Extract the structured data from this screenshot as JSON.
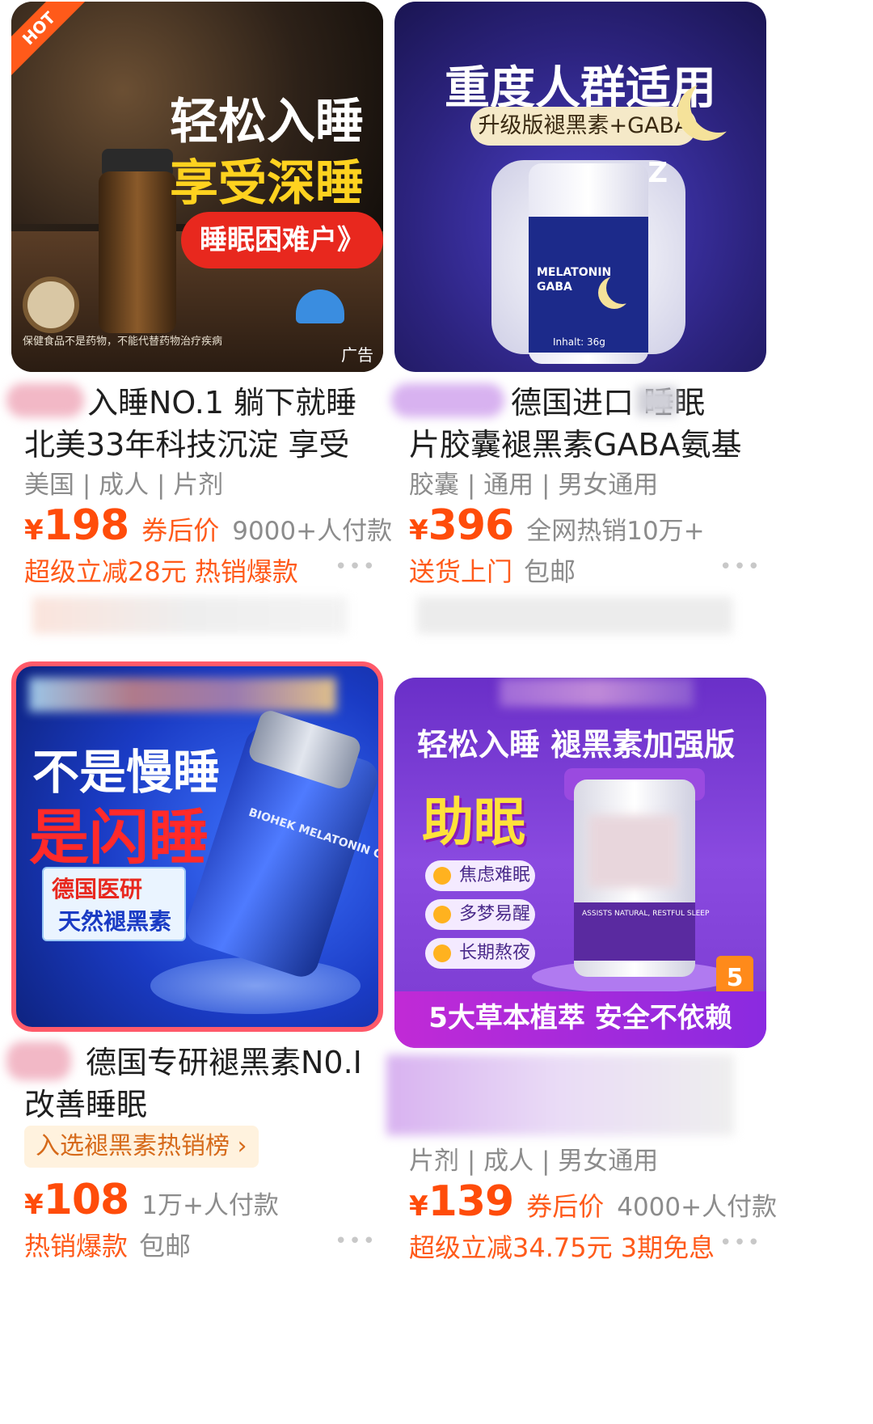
{
  "products": [
    {
      "image": {
        "hot_badge": "HOT",
        "headline_1": "轻松入睡",
        "headline_2": "享受深睡",
        "button": "睡眠困难户》",
        "fine_print": "保健食品不是药物，不能代替药物治疗疾病",
        "ad_label": "广告"
      },
      "title_line_1": "入睡NO.1 躺下就睡",
      "title_line_2": "北美33年科技沉淀 享受",
      "attributes": "美国 | 成人 | 片剂",
      "currency": "¥",
      "price": "198",
      "price_note": "券后价",
      "sales": "9000+人付款",
      "promo": "超级立减28元 热销爆款",
      "promo_gray": ""
    },
    {
      "image": {
        "headline": "重度人群适用",
        "pill": "升级版褪黑素+GABA",
        "jar_text_1": "MELATONIN",
        "jar_text_2": "GABA",
        "jar_net": "Inhalt: 36g",
        "zz": "Z"
      },
      "title_line_1": "德国进口   睡眠",
      "title_line_2": "片胶囊褪黑素GABA氨基",
      "attributes": "胶囊 | 通用 | 男女通用",
      "currency": "¥",
      "price": "396",
      "price_note": "",
      "sales": "全网热销10万+",
      "promo": "送货上门",
      "promo_gray": "包邮"
    },
    {
      "image": {
        "headline_1": "不是慢睡",
        "headline_2": "是闪睡",
        "tag_1": "德国医研",
        "tag_2": "天然褪黑素",
        "bottle_text": "BIOHEK MELATONIN CAPSULES"
      },
      "title_line_1": "德国专研褪黑素N0.I",
      "title_line_2": "改善睡眠",
      "rank": "入选褪黑素热销榜 ›",
      "currency": "¥",
      "price": "108",
      "price_note": "",
      "sales": "1万+人付款",
      "promo": "热销爆款",
      "promo_gray": "包邮"
    },
    {
      "image": {
        "headline_1": "轻松入睡 褪黑素加强版",
        "headline_2": "助眠",
        "tags": [
          "焦虑难眠",
          "多梦易醒",
          "长期熬夜"
        ],
        "jar_text": "ASSISTS NATURAL, RESTFUL SLEEP",
        "badge": "5",
        "bottom_bar": "5大草本植萃 安全不依赖"
      },
      "attributes": "片剂 | 成人 | 男女通用",
      "currency": "¥",
      "price": "139",
      "price_note": "券后价",
      "sales": "4000+人付款",
      "promo": "超级立减34.75元 3期免息",
      "promo_gray": ""
    }
  ],
  "more_icon": "•••"
}
